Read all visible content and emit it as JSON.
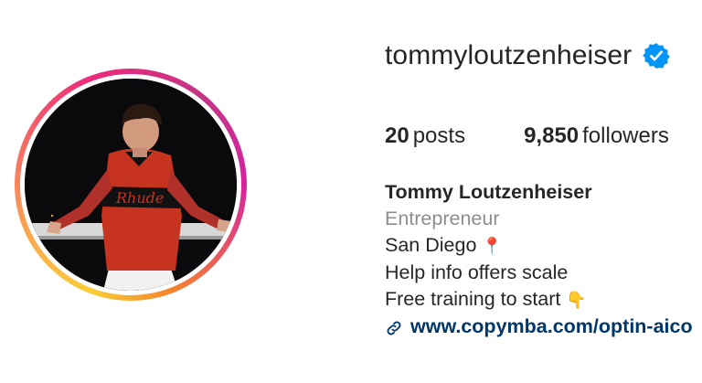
{
  "profile": {
    "username": "tommyloutzenheiser",
    "verified_icon": "verified-badge-icon",
    "avatar_icon": "profile-photo"
  },
  "stats": {
    "posts_count": "20",
    "posts_label": "posts",
    "followers_count": "9,850",
    "followers_label": "followers"
  },
  "bio": {
    "full_name": "Tommy Loutzenheiser",
    "category": "Entrepreneur",
    "location": "San Diego",
    "location_emoji": "📍",
    "line1": "Help info offers scale",
    "line2": "Free training to start",
    "line2_emoji": "👇",
    "link": "www.copymba.com/optin-aico"
  },
  "colors": {
    "text": "#262626",
    "secondary": "#8e8e8e",
    "link": "#00376b",
    "verified": "#0095f6"
  }
}
